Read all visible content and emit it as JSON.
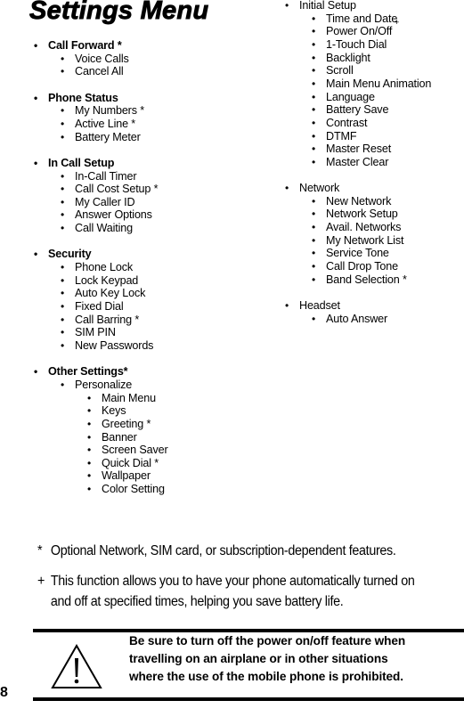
{
  "title": "Settings Menu",
  "left_column": [
    {
      "label": "Call Forward *",
      "children": [
        {
          "label": "Voice Calls"
        },
        {
          "label": "Cancel All"
        }
      ]
    },
    {
      "label": "Phone Status",
      "children": [
        {
          "label": "My Numbers *"
        },
        {
          "label": "Active Line *"
        },
        {
          "label": "Battery Meter"
        }
      ]
    },
    {
      "label": "In Call Setup",
      "children": [
        {
          "label": "In-Call Timer"
        },
        {
          "label": "Call Cost Setup *"
        },
        {
          "label": "My Caller ID"
        },
        {
          "label": "Answer Options"
        },
        {
          "label": "Call Waiting"
        }
      ]
    },
    {
      "label": "Security",
      "children": [
        {
          "label": "Phone Lock"
        },
        {
          "label": "Lock Keypad"
        },
        {
          "label": "Auto Key Lock"
        },
        {
          "label": "Fixed Dial"
        },
        {
          "label": "Call Barring *"
        },
        {
          "label": "SIM PIN"
        },
        {
          "label": "New Passwords"
        }
      ]
    },
    {
      "label": "Other Settings*",
      "children": [
        {
          "label": "Personalize",
          "children": [
            {
              "label": "Main Menu"
            },
            {
              "label": "Keys"
            },
            {
              "label": "Greeting *"
            },
            {
              "label": "Banner"
            },
            {
              "label": "Screen Saver"
            },
            {
              "label": "Quick Dial *"
            },
            {
              "label": "Wallpaper"
            },
            {
              "label": "Color Setting"
            }
          ]
        }
      ]
    }
  ],
  "right_column": [
    {
      "label": "Initial Setup",
      "children": [
        {
          "label": "Time and Date"
        },
        {
          "label": "Power On/Off",
          "mark": "+"
        },
        {
          "label": "1-Touch Dial"
        },
        {
          "label": "Backlight"
        },
        {
          "label": "Scroll"
        },
        {
          "label": "Main Menu Animation"
        },
        {
          "label": "Language"
        },
        {
          "label": "Battery Save"
        },
        {
          "label": "Contrast"
        },
        {
          "label": "DTMF"
        },
        {
          "label": "Master Reset"
        },
        {
          "label": "Master Clear"
        }
      ]
    },
    {
      "label": "Network",
      "children": [
        {
          "label": "New Network"
        },
        {
          "label": "Network Setup"
        },
        {
          "label": "Avail. Networks"
        },
        {
          "label": "My Network List"
        },
        {
          "label": "Service Tone"
        },
        {
          "label": "Call Drop Tone"
        },
        {
          "label": "Band Selection *"
        }
      ]
    },
    {
      "label": "Headset",
      "children": [
        {
          "label": "Auto Answer"
        }
      ]
    }
  ],
  "bullet": "•",
  "notes": [
    {
      "mark": "*",
      "lines": [
        "Optional Network, SIM card, or subscription-dependent features."
      ]
    },
    {
      "mark": "+",
      "lines": [
        "This function allows you to have your phone automatically turned on",
        "and off at specified times, helping you save battery life."
      ]
    }
  ],
  "warning": {
    "icon": "warning-triangle-icon",
    "lines": [
      "Be sure to turn off the power on/off feature when",
      "travelling on an airplane or in other situations",
      "where the use of the mobile phone is prohibited."
    ]
  },
  "page_number": "8"
}
